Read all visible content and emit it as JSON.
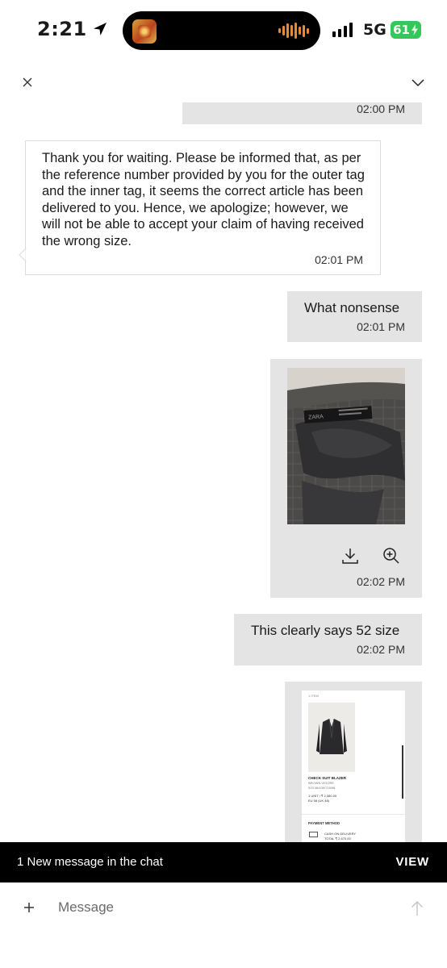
{
  "status_bar": {
    "time": "2:21",
    "network": "5G",
    "battery": "61"
  },
  "icons": {
    "location": "location-arrow-icon",
    "signal": "cellular-signal-icon",
    "battery_bolt": "charging-bolt-icon",
    "close": "close-icon",
    "collapse": "chevron-down-icon",
    "download": "download-icon",
    "zoom": "zoom-in-icon",
    "add": "plus-icon",
    "send": "send-arrow-icon"
  },
  "colors": {
    "battery": "#34c759",
    "outgoing_bubble": "#e4e4e4",
    "banner": "#000000"
  },
  "messages": [
    {
      "direction": "out",
      "time": "02:00 PM"
    },
    {
      "direction": "in",
      "text": "Thank you for waiting. Please be informed that, as per the reference number provided by you for the outer tag and the inner tag, it seems the correct article has been delivered to you. Hence, we apologize; however, we will not be able to accept your claim of having received the wrong size.",
      "time": "02:01 PM"
    },
    {
      "direction": "out",
      "text": "What nonsense",
      "time": "02:01 PM"
    },
    {
      "direction": "out",
      "type": "image",
      "time": "02:02 PM"
    },
    {
      "direction": "out",
      "text": "This clearly says 52 size",
      "time": "02:02 PM"
    },
    {
      "direction": "out",
      "type": "image"
    }
  ],
  "receipt": {
    "top_line": "1 ITEM",
    "product_name": "CHECK SUIT BLAZER",
    "color": "BROWN VIGORE",
    "ref": "0/3746/439/716/98",
    "units_price": "1 UNIT / ₹ 2,380.00",
    "size": "EU 58 (UK 48)",
    "payment_heading": "PAYMENT METHOD",
    "payment_method": "CASH ON DELIVERY",
    "total": "TOTAL ₹ 2,670.00"
  },
  "banner": {
    "text": "1 New message in the chat",
    "action": "VIEW"
  },
  "composer": {
    "placeholder": "Message"
  }
}
